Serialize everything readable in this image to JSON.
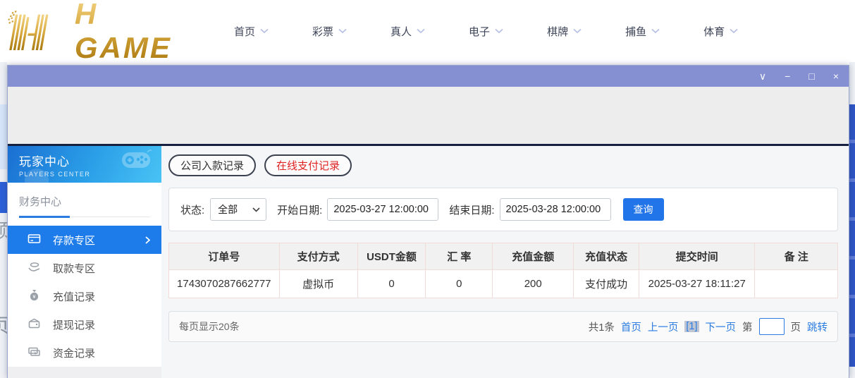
{
  "logo": {
    "text": "H GAME"
  },
  "nav": {
    "items": [
      {
        "label": "首页"
      },
      {
        "label": "彩票"
      },
      {
        "label": "真人"
      },
      {
        "label": "电子"
      },
      {
        "label": "棋牌"
      },
      {
        "label": "捕鱼"
      },
      {
        "label": "体育"
      }
    ]
  },
  "window": {
    "controls": [
      {
        "name": "dropdown",
        "glyph": "∨"
      },
      {
        "name": "minimize",
        "glyph": "−"
      },
      {
        "name": "maximize",
        "glyph": "□"
      },
      {
        "name": "close",
        "glyph": "×"
      }
    ]
  },
  "sidebar": {
    "banner": {
      "title": "玩家中心",
      "subtitle": "PLAYERS CENTER"
    },
    "section_title": "财务中心",
    "menu": [
      {
        "label": "存款专区",
        "icon": "deposit-card-icon",
        "active": true
      },
      {
        "label": "取款专区",
        "icon": "withdraw-hand-icon",
        "active": false
      },
      {
        "label": "充值记录",
        "icon": "money-bag-icon",
        "active": false
      },
      {
        "label": "提现记录",
        "icon": "wallet-icon",
        "active": false
      },
      {
        "label": "资金记录",
        "icon": "banknotes-icon",
        "active": false
      }
    ]
  },
  "main": {
    "tabs": [
      {
        "label": "公司入款记录",
        "style": "normal"
      },
      {
        "label": "在线支付记录",
        "style": "red"
      }
    ],
    "filters": {
      "status_label": "状态:",
      "status_value": "全部",
      "start_label": "开始日期:",
      "start_value": "2025-03-27 12:00:00",
      "end_label": "结束日期:",
      "end_value": "2025-03-28 12:00:00",
      "search_button": "查询"
    },
    "table": {
      "headers": [
        "订单号",
        "支付方式",
        "USDT金额",
        "汇 率",
        "充值金额",
        "充值状态",
        "提交时间",
        "备 注"
      ],
      "rows": [
        [
          "1743070287662777",
          "虚拟币",
          "0",
          "0",
          "200",
          "支付成功",
          "2025-03-27 18:11:27",
          ""
        ]
      ]
    },
    "pagination": {
      "page_size_text": "每页显示20条",
      "total_text": "共1条",
      "first_label": "首页",
      "prev_label": "上一页",
      "current_page_label": "[1]",
      "next_label": "下一页",
      "jump_prefix": "第",
      "jump_suffix": "页",
      "jump_button_label": "跳转",
      "jump_value": ""
    }
  },
  "background_fragments": {
    "glyph_1": "预",
    "glyph_2": "页"
  },
  "colors": {
    "titlebar": "#8590d3",
    "navy_divider": "#16203f",
    "accent_blue": "#1d7ce9",
    "link_blue": "#2a7ce0",
    "search_button_blue": "#2175e8",
    "tab_red": "#e12222",
    "table_border_pink": "#f2dcda",
    "banner_gradient_start": "#1a6fd2",
    "banner_gradient_end": "#49c3f5",
    "logo_gold": "#d8a93f"
  }
}
